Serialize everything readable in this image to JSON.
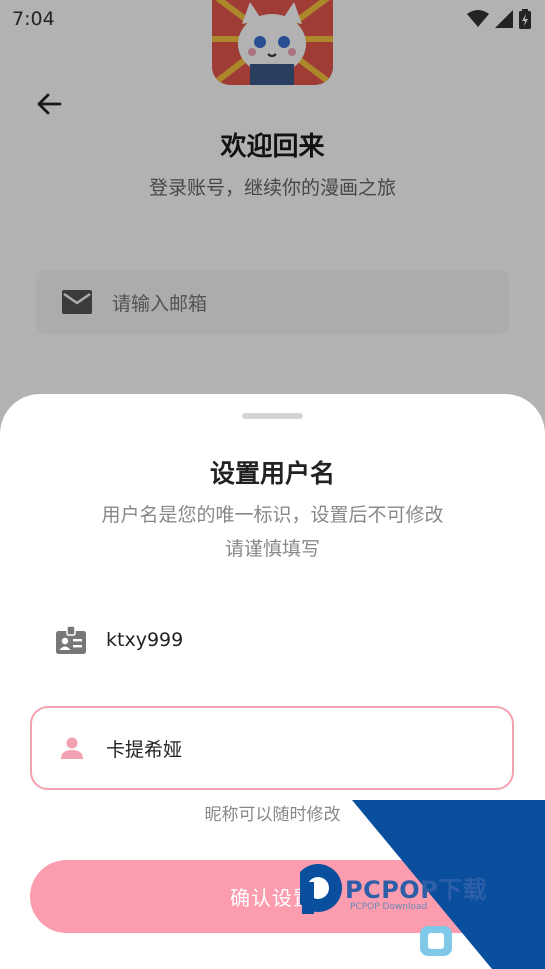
{
  "status_bar": {
    "time": "7:04"
  },
  "login": {
    "title": "欢迎回来",
    "subtitle": "登录账号，继续你的漫画之旅",
    "email_placeholder": "请输入邮箱"
  },
  "sheet": {
    "title": "设置用户名",
    "description_line1": "用户名是您的唯一标识，设置后不可修改",
    "description_line2": "请谨慎填写",
    "user_id": "ktxy999",
    "nickname_value": "卡提希娅",
    "nickname_hint": "昵称可以随时修改",
    "confirm_label": "确认设置"
  },
  "watermark": {
    "text": "PCPOP下载",
    "sub": "PCPOP Download"
  },
  "colors": {
    "accent_pink": "#fb9daf",
    "field_border": "#f2a2b0",
    "watermark_blue": "#0a4f9e"
  },
  "icons": [
    "back-arrow-icon",
    "mail-icon",
    "id-card-icon",
    "person-icon",
    "wifi-icon",
    "signal-icon",
    "battery-icon"
  ]
}
